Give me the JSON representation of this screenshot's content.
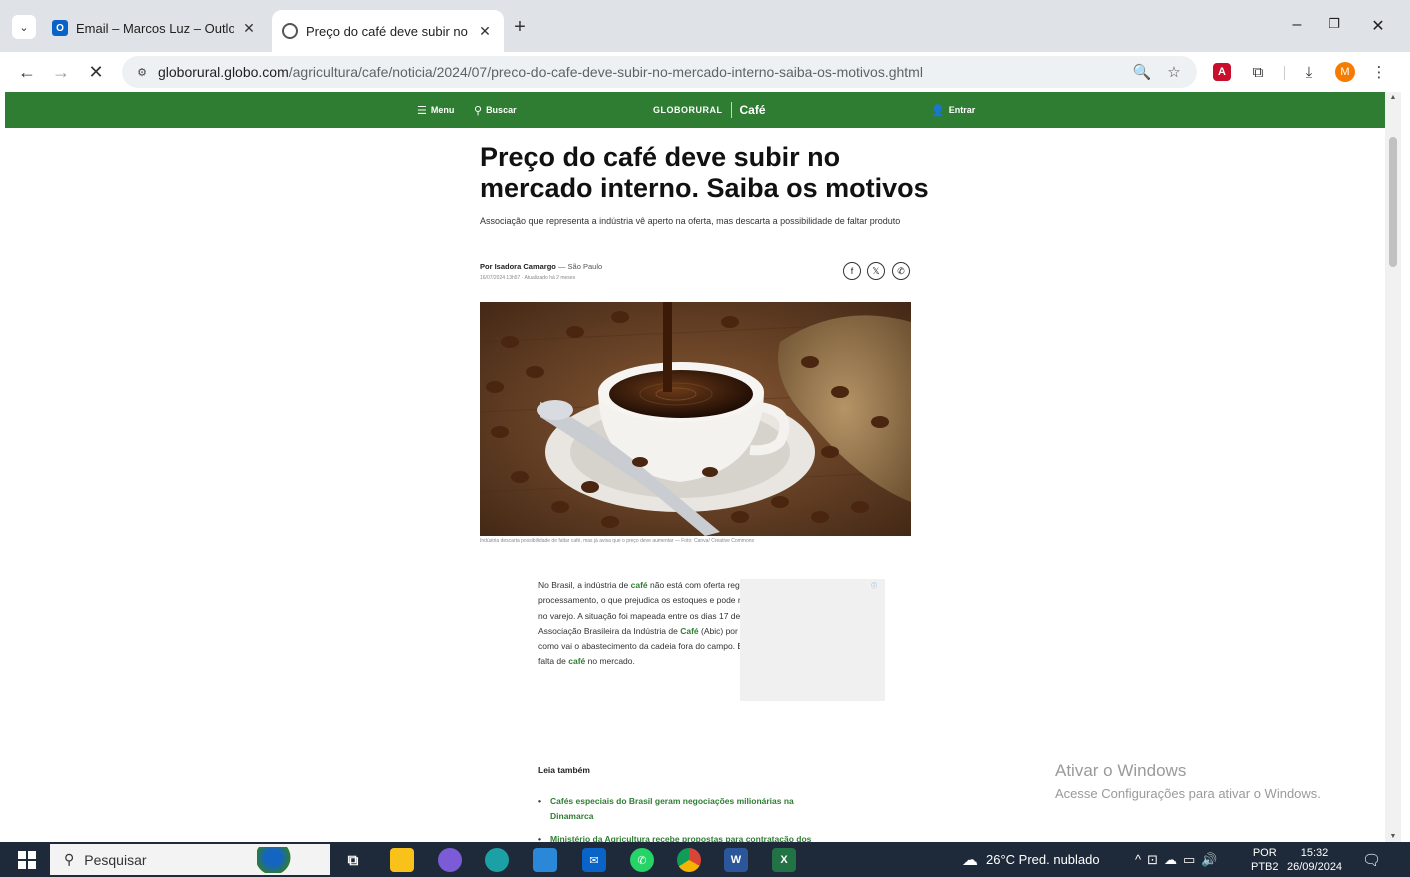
{
  "browser": {
    "tabs": [
      {
        "title": "Email – Marcos Luz – Outlook",
        "active": false
      },
      {
        "title": "Preço do café deve subir no me",
        "active": true
      }
    ],
    "url_domain": "globorural.globo.com",
    "url_path": "/agricultura/cafe/noticia/2024/07/preco-do-cafe-deve-subir-no-mercado-interno-saiba-os-motivos.ghtml",
    "profile_initial": "M",
    "accent": "#2e7d32"
  },
  "site_header": {
    "menu_label": "Menu",
    "search_label": "Buscar",
    "logo": "GLOBORURAL",
    "section": "Café",
    "login_label": "Entrar"
  },
  "article": {
    "headline": "Preço do café deve subir no mercado interno. Saiba os motivos",
    "subhead": "Associação que representa a indústria vê aperto na oferta, mas descarta a possibilidade de faltar produto",
    "byline_prefix": "Por ",
    "author": "Isadora Camargo",
    "location": " — São Paulo",
    "dateline": "16/07/2024 13h57 · Atualizado há 2 meses",
    "image_caption": "Indústria descarta possibilidade de faltar café, mas já avisa que o preço deve aumentar — Foto: Canva/ Creative Commons",
    "paragraph": {
      "p1": "No Brasil, a indústria de ",
      "k1": "café",
      "p2": " não está com oferta regular do grão para processamento, o que prejudica os estoques e pode refletir em aumento de preços no varejo. A situação foi mapeada entre os dias 17 de junho e 28 de junho pela Associação Brasileira da Indústria de ",
      "k2": "Café",
      "p3": " (Abic) por meio de um cálculo que indica como vai o abastecimento da cadeia fora do campo. Entretanto, a entidade descarta falta de ",
      "k3": "café",
      "p4": " no mercado."
    },
    "related_title": "Leia também",
    "related": [
      "Cafés especiais do Brasil geram negociações milionárias na Dinamarca",
      "Ministério da Agricultura recebe propostas para contratação dos"
    ]
  },
  "watermark": {
    "line1": "Ativar o Windows",
    "line2": "Acesse Configurações para ativar o Windows."
  },
  "taskbar": {
    "search_placeholder": "Pesquisar",
    "weather": "26°C  Pred. nublado",
    "lang_top": "POR",
    "lang_bottom": "PTB2",
    "time": "15:32",
    "date": "26/09/2024"
  }
}
